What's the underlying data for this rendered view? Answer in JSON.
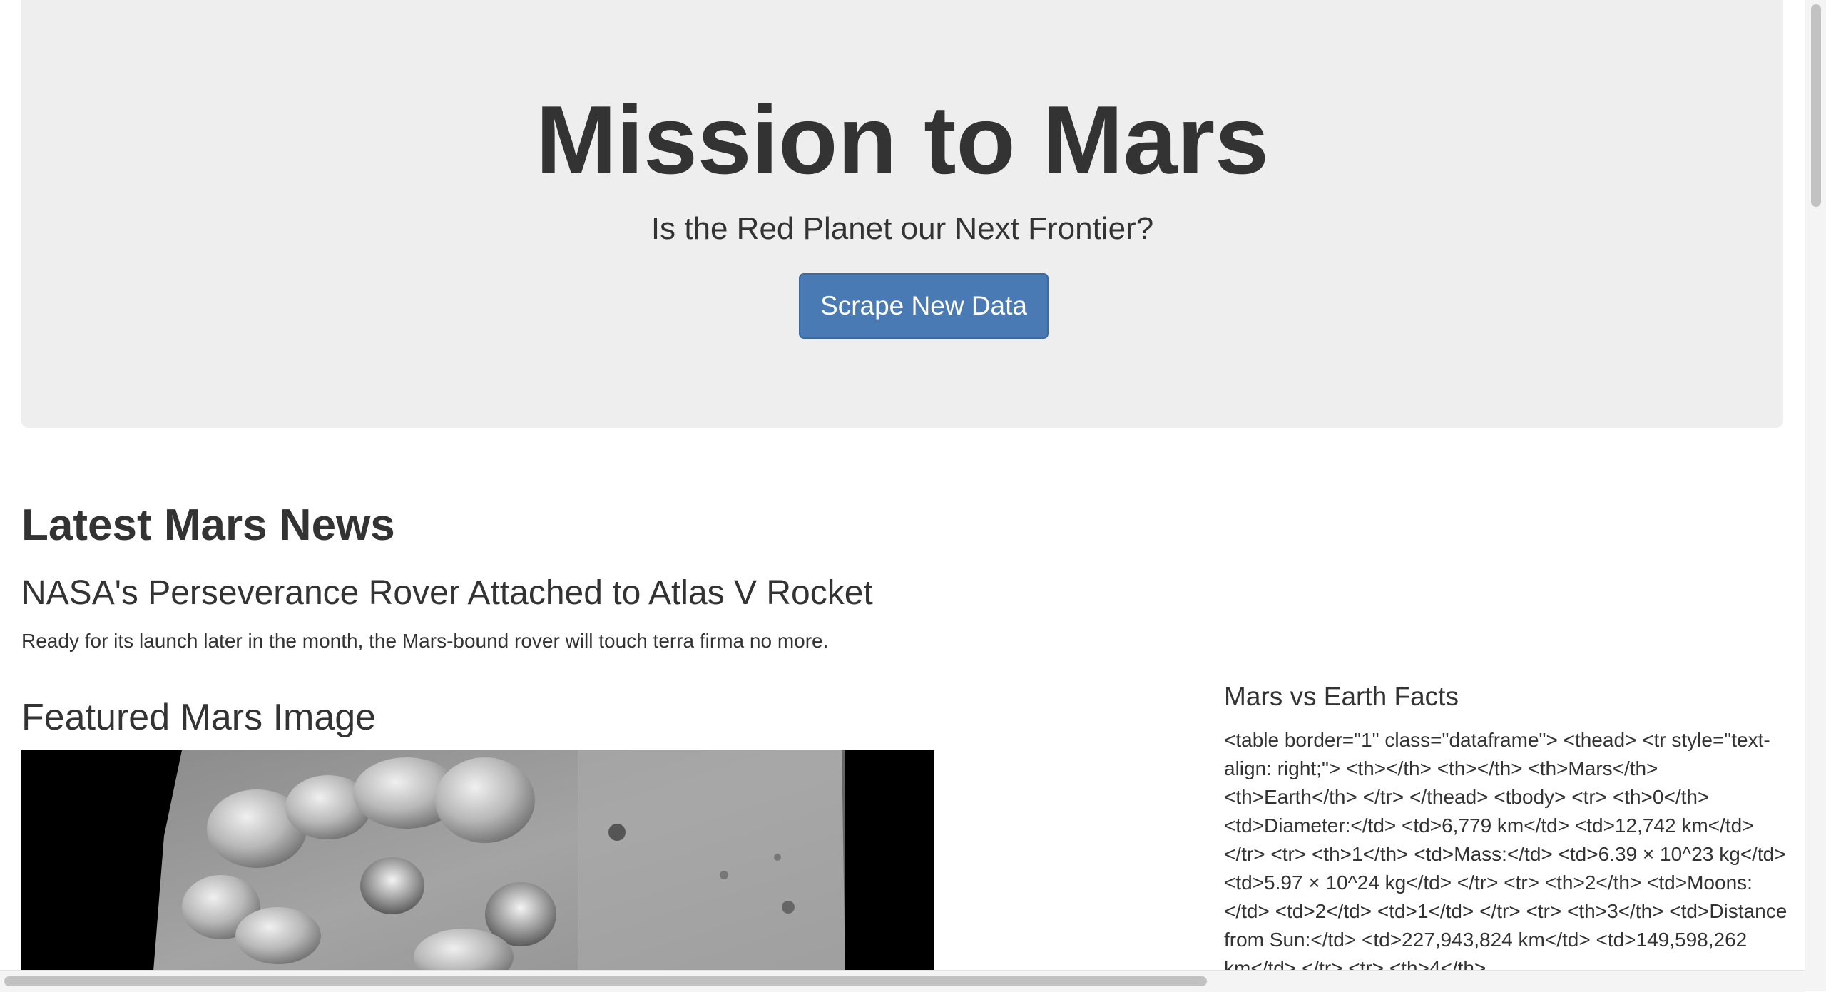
{
  "jumbotron": {
    "title": "Mission to Mars",
    "subtitle": "Is the Red Planet our Next Frontier?",
    "button_label": "Scrape New Data",
    "button_color": "#4a7ab4"
  },
  "news": {
    "section_title": "Latest Mars News",
    "headline": "NASA's Perseverance Rover Attached to Atlas V Rocket",
    "paragraph": "Ready for its launch later in the month, the Mars-bound rover will touch terra firma no more."
  },
  "featured_image": {
    "section_title": "Featured Mars Image"
  },
  "facts": {
    "section_title": "Mars vs Earth Facts",
    "raw_html_text": "<table border=\"1\" class=\"dataframe\"> <thead> <tr style=\"text-align: right;\"> <th></th> <th></th> <th>Mars</th> <th>Earth</th> </tr> </thead> <tbody> <tr> <th>0</th> <td>Diameter:</td> <td>6,779 km</td> <td>12,742 km</td> </tr> <tr> <th>1</th> <td>Mass:</td> <td>6.39 × 10^23 kg</td> <td>5.97 × 10^24 kg</td> </tr> <tr> <th>2</th> <td>Moons:</td> <td>2</td> <td>1</td> </tr> <tr> <th>3</th> <td>Distance from Sun:</td> <td>227,943,824 km</td> <td>149,598,262 km</td> </tr> <tr> <th>4</th>"
  }
}
